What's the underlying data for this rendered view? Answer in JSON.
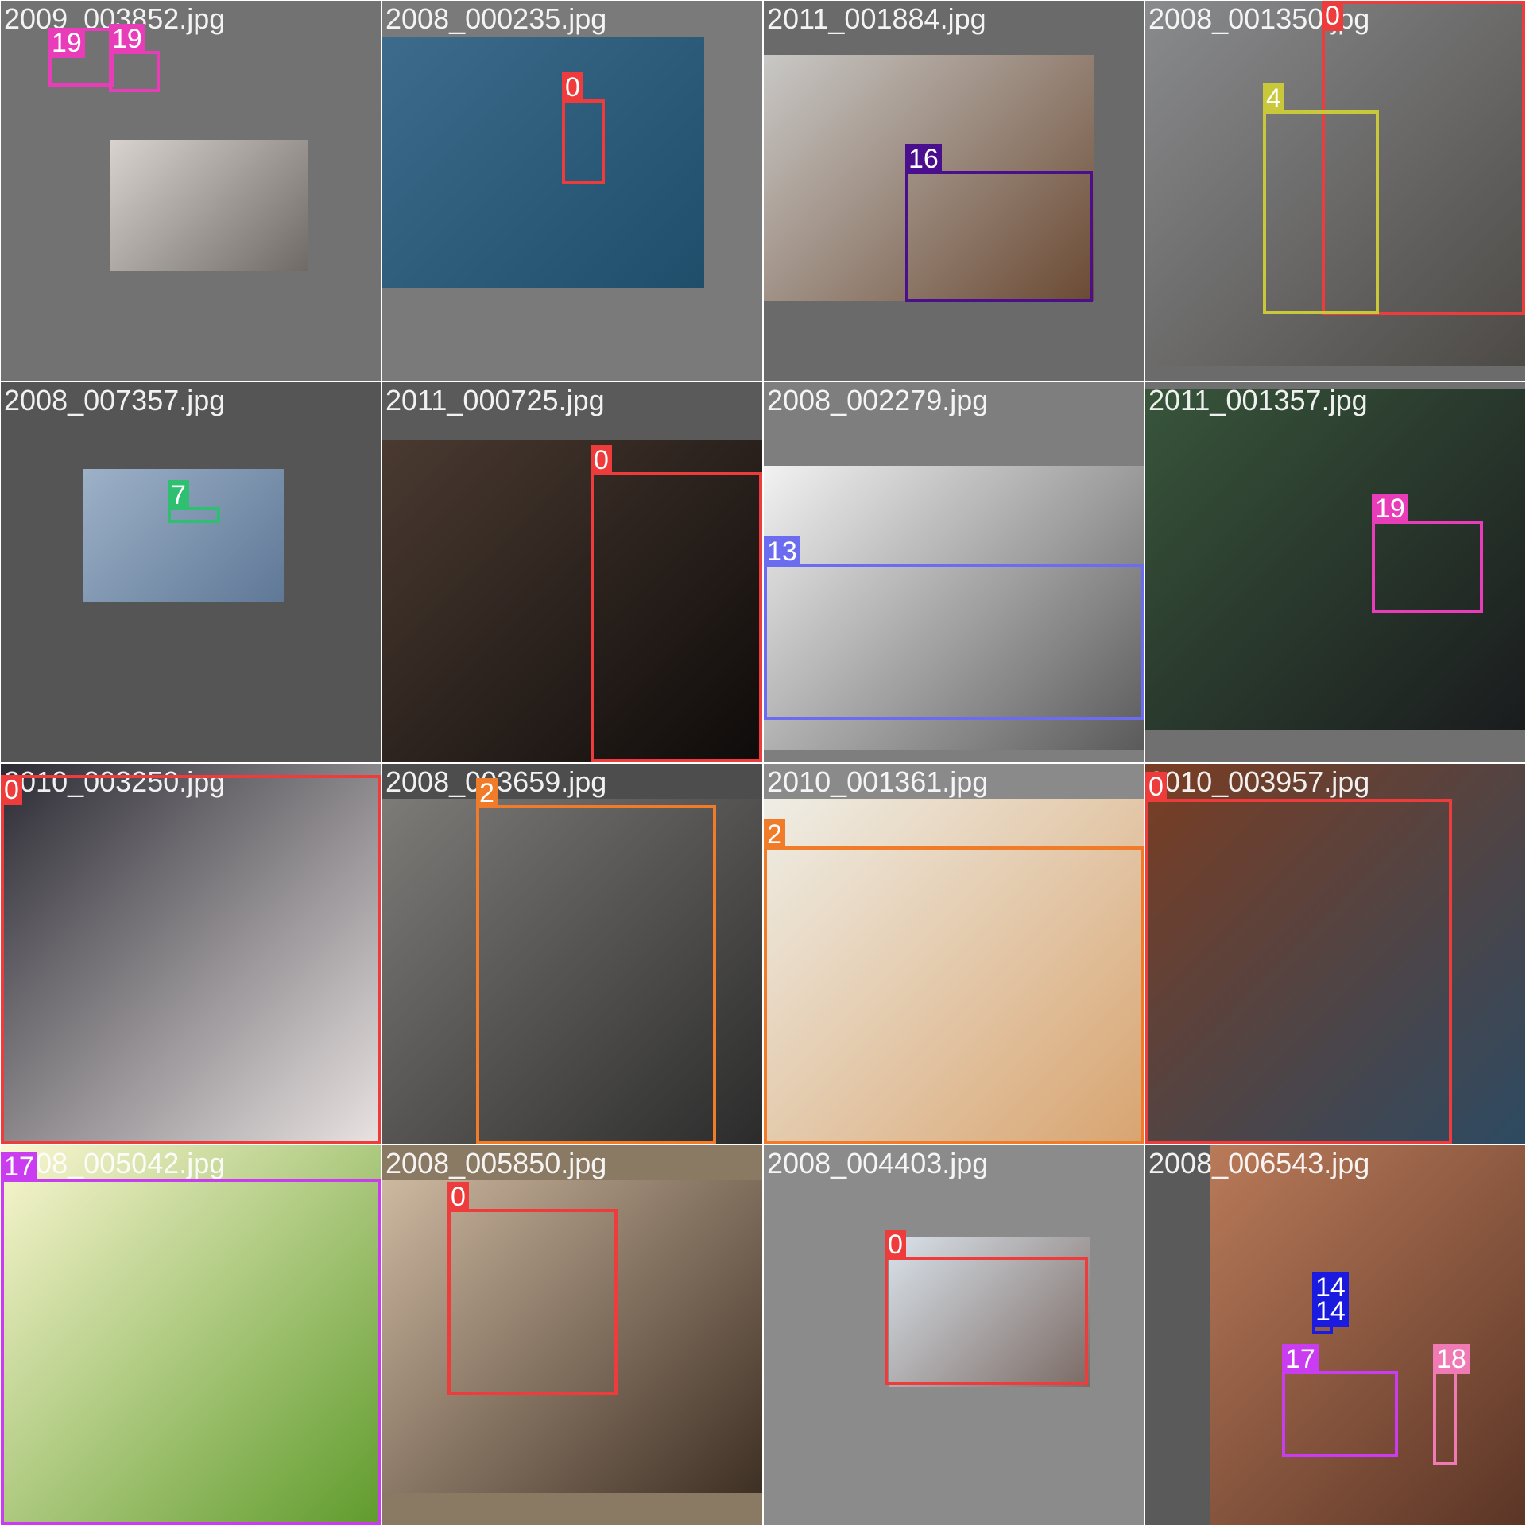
{
  "tiles": [
    {
      "file": "2009_003852.jpg",
      "bg": "#727272",
      "photo": {
        "c1": "#d8d3cf",
        "c2": "#6f6a66"
      },
      "boxes": [
        {
          "label": "19",
          "color": "#e93cb9"
        },
        {
          "label": "19",
          "color": "#e93cb9"
        }
      ]
    },
    {
      "file": "2008_000235.jpg",
      "bg": "#7a7a7a",
      "photo": {
        "c1": "#3d6b8c",
        "c2": "#1e4e6a"
      },
      "boxes": [
        {
          "label": "0",
          "color": "#ee3b3b"
        }
      ]
    },
    {
      "file": "2011_001884.jpg",
      "bg": "#6a6a6a",
      "photo": {
        "c1": "#c9c8c6",
        "c2": "#6b4a33"
      },
      "boxes": [
        {
          "label": "16",
          "color": "#4a0f8c"
        }
      ]
    },
    {
      "file": "2008_001350.jpg",
      "bg": "#6b6b6b",
      "photo": {
        "c1": "#8a8b8e",
        "c2": "#4d4a46"
      },
      "boxes": [
        {
          "label": "0",
          "color": "#ee3b3b"
        },
        {
          "label": "4",
          "color": "#c8c83a"
        }
      ]
    },
    {
      "file": "2008_007357.jpg",
      "bg": "#555555",
      "photo": {
        "c1": "#9db1c8",
        "c2": "#5f7896"
      },
      "boxes": [
        {
          "label": "7",
          "color": "#2fbf71"
        }
      ]
    },
    {
      "file": "2011_000725.jpg",
      "bg": "#5a5a5a",
      "photo": {
        "c1": "#4a3a31",
        "c2": "#0e0b0a"
      },
      "boxes": [
        {
          "label": "0",
          "color": "#ee3b3b"
        }
      ]
    },
    {
      "file": "2008_002279.jpg",
      "bg": "#7e7e7e",
      "photo": {
        "c1": "#f2f2f2",
        "c2": "#5a5a5a"
      },
      "boxes": [
        {
          "label": "13",
          "color": "#6c6cf0"
        }
      ]
    },
    {
      "file": "2011_001357.jpg",
      "bg": "#707070",
      "photo": {
        "c1": "#38553b",
        "c2": "#1a1c1e"
      },
      "boxes": [
        {
          "label": "19",
          "color": "#e93cb9"
        }
      ]
    },
    {
      "file": "2010_003250.jpg",
      "bg": "#333333",
      "photo": {
        "c1": "#2b2a33",
        "c2": "#e9e3e2"
      },
      "boxes": [
        {
          "label": "0",
          "color": "#ee3b3b"
        }
      ]
    },
    {
      "file": "2008_003659.jpg",
      "bg": "#4d4d4d",
      "photo": {
        "c1": "#7d7b78",
        "c2": "#2b2b2b"
      },
      "boxes": [
        {
          "label": "2",
          "color": "#f07c2a"
        }
      ]
    },
    {
      "file": "2010_001361.jpg",
      "bg": "#8a8a8a",
      "photo": {
        "c1": "#efeee6",
        "c2": "#d8a470"
      },
      "boxes": [
        {
          "label": "2",
          "color": "#f07c2a"
        }
      ]
    },
    {
      "file": "2010_003957.jpg",
      "bg": "#4a4a4a",
      "photo": {
        "c1": "#7a3d22",
        "c2": "#2d4a62"
      },
      "boxes": [
        {
          "label": "0",
          "color": "#ee3b3b"
        }
      ]
    },
    {
      "file": "2008_005042.jpg",
      "bg": "#f7f4c9",
      "photo": {
        "c1": "#fbf7d2",
        "c2": "#5f9b2c"
      },
      "boxes": [
        {
          "label": "17",
          "color": "#c93cf0"
        }
      ]
    },
    {
      "file": "2008_005850.jpg",
      "bg": "#8a7a64",
      "photo": {
        "c1": "#cdb8a0",
        "c2": "#3e2f24"
      },
      "boxes": [
        {
          "label": "0",
          "color": "#ee3b3b"
        }
      ]
    },
    {
      "file": "2008_004403.jpg",
      "bg": "#8b8b8b",
      "photo": {
        "c1": "#d9e2ea",
        "c2": "#7b6a64"
      },
      "boxes": [
        {
          "label": "0",
          "color": "#ee3b3b"
        }
      ]
    },
    {
      "file": "2008_006543.jpg",
      "bg": "#5a5a5a",
      "photo": {
        "c1": "#b97a59",
        "c2": "#5b3526"
      },
      "boxes": [
        {
          "label": "14",
          "color": "#1b1be0"
        },
        {
          "label": "14",
          "color": "#1b1be0"
        },
        {
          "label": "17",
          "color": "#c93cf0"
        },
        {
          "label": "18",
          "color": "#f07ab4"
        }
      ]
    }
  ]
}
